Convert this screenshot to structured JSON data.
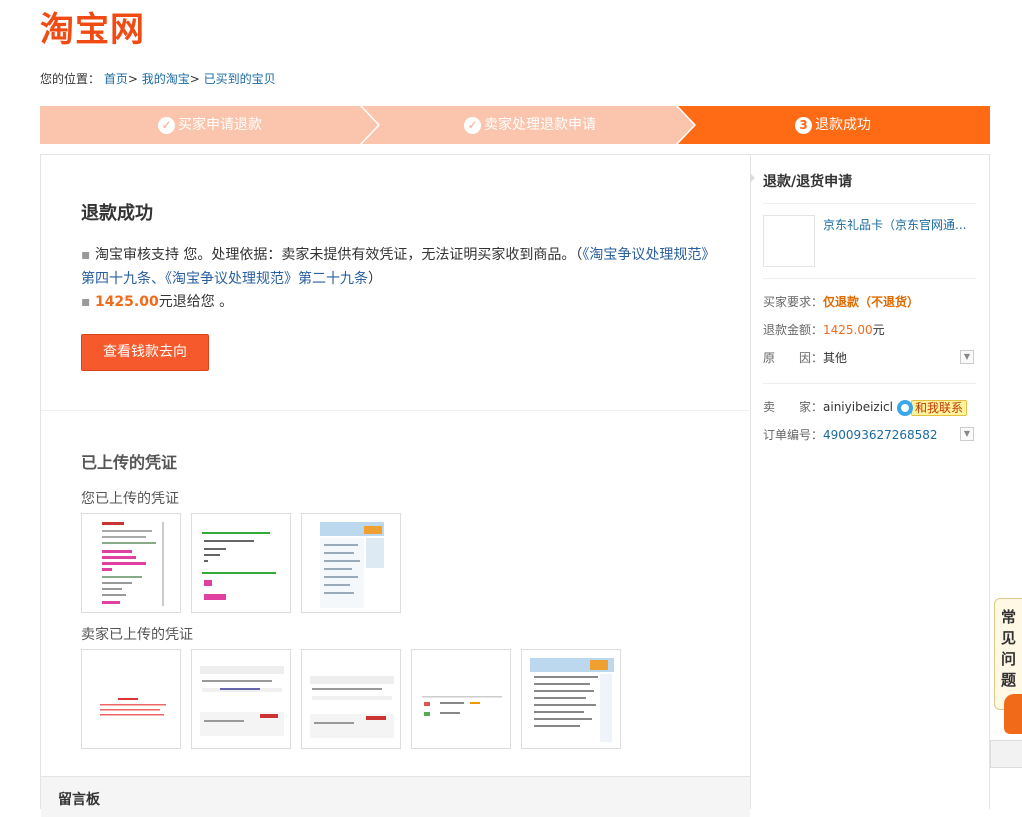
{
  "logo": "淘宝网",
  "breadcrumb": {
    "label": "您的位置：",
    "items": [
      "首页",
      "我的淘宝",
      "已买到的宝贝"
    ],
    "sep": ">"
  },
  "steps": [
    {
      "label": "买家申请退款",
      "state": "done"
    },
    {
      "label": "卖家处理退款申请",
      "state": "done"
    },
    {
      "label": "退款成功",
      "number": "3",
      "state": "current"
    }
  ],
  "result": {
    "title": "退款成功",
    "line1_prefix": "淘宝审核支持 您。处理依据：卖家未提供有效凭证，无法证明买家收到商品。（",
    "line1_link": "《淘宝争议处理规范》第四十九条、《淘宝争议处理规范》第二十九条",
    "line1_suffix": "）",
    "amount": "1425.00",
    "line2_suffix": "元退给您 。",
    "button": "查看钱款去向"
  },
  "evidence": {
    "title": "已上传的凭证",
    "buyer_label": "您已上传的凭证",
    "seller_label": "卖家已上传的凭证",
    "buyer_count": 3,
    "seller_count": 5
  },
  "message_board": "留言板",
  "side": {
    "title": "退款/退货申请",
    "product_name": "京东礼品卡（京东官网通...",
    "rows": {
      "require_label": "买家要求：",
      "require_value": "仅退款（不退货）",
      "amount_label": "退款金额：",
      "amount_value": "1425.00",
      "amount_unit": "元",
      "reason_label": "原　　因：",
      "reason_value": "其他",
      "seller_label": "卖　　家：",
      "seller_value": "ainiyibeizicl",
      "contact": "和我联系",
      "order_label": "订单编号：",
      "order_value": "490093627268582"
    }
  },
  "faq": "常见问题",
  "colors": {
    "brand": "#f14b14",
    "step_done": "#fbc4ad",
    "step_current": "#ff6a14",
    "button": "#f6592b"
  }
}
